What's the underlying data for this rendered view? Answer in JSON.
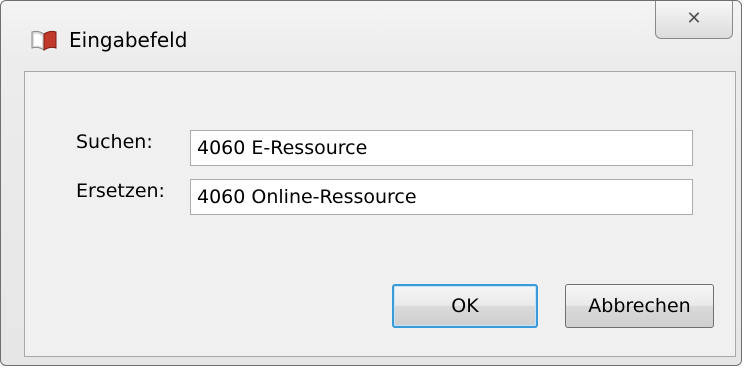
{
  "window": {
    "title": "Eingabefeld",
    "icon": "book-app-icon",
    "close_glyph": "✕"
  },
  "form": {
    "search_label": "Suchen:",
    "search_value": "4060 E-Ressource",
    "replace_label": "Ersetzen:",
    "replace_value": "4060 Online-Ressource"
  },
  "buttons": {
    "ok_label": "OK",
    "cancel_label": "Abbrechen"
  },
  "colors": {
    "accent_focus": "#3c9ad8",
    "icon_red": "#c0392b"
  }
}
